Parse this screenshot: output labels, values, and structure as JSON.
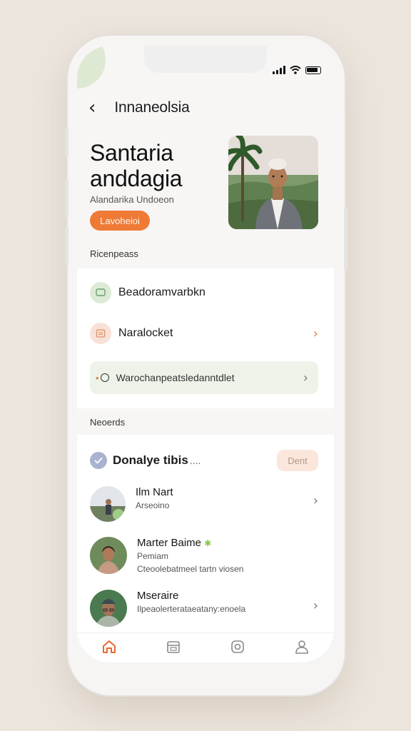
{
  "colors": {
    "accent": "#ef7a36",
    "green_tint": "#eef3ea",
    "background": "#ece5dc"
  },
  "header": {
    "title": "Innaneolsia",
    "back_icon": "chevron-left-icon"
  },
  "hero": {
    "title_line1": "Santaria",
    "title_line2": "anddagia",
    "subtitle": "Alandarika Undoeon",
    "button_label": "Lavoheioi"
  },
  "section1": {
    "label": "Ricenpeass",
    "items": [
      {
        "label": "Beadoramvarbkn",
        "icon": "message-icon"
      },
      {
        "label": "Naralocket",
        "icon": "document-icon"
      }
    ],
    "pill": {
      "label": "Warochanpeatsledanntdlet",
      "icon": "clock-icon"
    }
  },
  "section2": {
    "label": "Neoerds",
    "header_title": "Donalye tibis",
    "header_ellipsis": "....",
    "header_button": "Dent",
    "contacts": [
      {
        "name": "Ilm Nart",
        "sub1": "Arseoino",
        "sub2": ""
      },
      {
        "name": "Marter Baime",
        "sub1": "Pemiam",
        "sub2": "Cteoolebatmeel tartn viosen"
      },
      {
        "name": "Mseraire",
        "sub1": "Ilpeaolerterataeatany:enoela",
        "sub2": ""
      }
    ]
  },
  "tabs": [
    {
      "icon": "home-icon"
    },
    {
      "icon": "calendar-icon"
    },
    {
      "icon": "camera-icon"
    },
    {
      "icon": "profile-icon"
    }
  ]
}
